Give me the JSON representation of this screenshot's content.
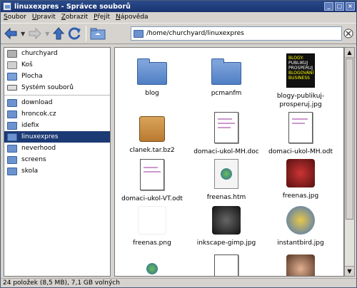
{
  "window": {
    "title": "linuxexpres - Správce souborů"
  },
  "menu": [
    {
      "u": "S",
      "rest": "oubor"
    },
    {
      "u": "U",
      "rest": "pravit"
    },
    {
      "u": "Z",
      "rest": "obrazit"
    },
    {
      "u": "P",
      "rest": "řejít"
    },
    {
      "u": "N",
      "rest": "ápověda"
    }
  ],
  "toolbar": {
    "location": "/home/churchyard/linuxexpres"
  },
  "sidebar": {
    "places": [
      {
        "label": "churchyard",
        "icon": "home-icon"
      },
      {
        "label": "Koš",
        "icon": "trash-icon"
      },
      {
        "label": "Plocha",
        "icon": "desktop-icon"
      },
      {
        "label": "Systém souborů",
        "icon": "drive-icon"
      }
    ],
    "bookmarks": [
      {
        "label": "download"
      },
      {
        "label": "hroncok.cz"
      },
      {
        "label": "idefix"
      },
      {
        "label": "linuxexpres",
        "selected": true
      },
      {
        "label": "neverhood"
      },
      {
        "label": "screens"
      },
      {
        "label": "skola"
      }
    ]
  },
  "files": [
    {
      "name": "blog",
      "type": "folder"
    },
    {
      "name": "pcmanfm",
      "type": "folder"
    },
    {
      "name": "blogy-publikuj-prosperuj.jpg",
      "type": "blog-image",
      "lines": [
        "BLOGY:",
        "PUBLIKUJ",
        "PROSPERUJ",
        "BLOGOVÁNÍ",
        "BUSINESS"
      ]
    },
    {
      "name": "clanek.tar.bz2",
      "type": "archive"
    },
    {
      "name": "domaci-ukol-MH.doc",
      "type": "doc"
    },
    {
      "name": "domaci-ukol-MH.odt",
      "type": "doc"
    },
    {
      "name": "domaci-ukol-VT.odt",
      "type": "doc"
    },
    {
      "name": "freenas.htm",
      "type": "html"
    },
    {
      "name": "freenas.jpg",
      "type": "image"
    },
    {
      "name": "freenas.png",
      "type": "image"
    },
    {
      "name": "inkscape-gimp.jpg",
      "type": "image"
    },
    {
      "name": "instantbird.jpg",
      "type": "image"
    },
    {
      "name": "",
      "type": "image"
    },
    {
      "name": "",
      "type": "doc"
    },
    {
      "name": "",
      "type": "image"
    }
  ],
  "status": {
    "text": "24 položek (8,5 MB), 7,1 GB volných"
  },
  "colors": {
    "titlebar": "#1a3370",
    "selection": "#1c3a74",
    "folder": "#6c93cf"
  }
}
